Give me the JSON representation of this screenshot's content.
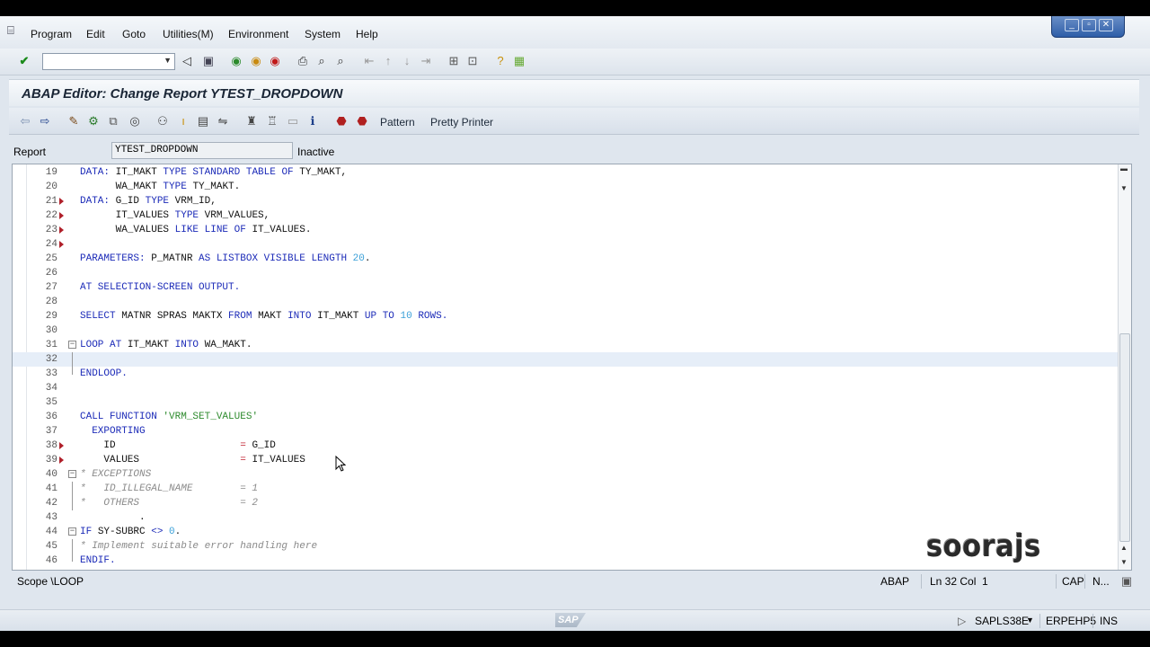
{
  "menu": {
    "items": [
      "Program",
      "Edit",
      "Goto",
      "Utilities(M)",
      "Environment",
      "System",
      "Help"
    ]
  },
  "window": {
    "title": "ABAP Editor: Change Report YTEST_DROPDOWN"
  },
  "apptoolbar": {
    "pattern_label": "Pattern",
    "pretty_printer_label": "Pretty Printer"
  },
  "report": {
    "label": "Report",
    "value": "YTEST_DROPDOWN",
    "status": "Inactive"
  },
  "code": {
    "current_line": 32,
    "lines": [
      {
        "n": "19",
        "bp": false,
        "fold": "",
        "parts": [
          [
            "kw",
            "DATA: "
          ],
          [
            "plain",
            "IT_MAKT "
          ],
          [
            "kw",
            "TYPE STANDARD TABLE OF "
          ],
          [
            "plain",
            "TY_MAKT,"
          ]
        ]
      },
      {
        "n": "20",
        "bp": false,
        "fold": "",
        "parts": [
          [
            "plain",
            "      WA_MAKT "
          ],
          [
            "kw",
            "TYPE "
          ],
          [
            "plain",
            "TY_MAKT."
          ]
        ]
      },
      {
        "n": "21",
        "bp": true,
        "fold": "",
        "parts": [
          [
            "kw",
            "DATA: "
          ],
          [
            "plain",
            "G_ID "
          ],
          [
            "kw",
            "TYPE "
          ],
          [
            "plain",
            "VRM_ID,"
          ]
        ]
      },
      {
        "n": "22",
        "bp": true,
        "fold": "",
        "parts": [
          [
            "plain",
            "      IT_VALUES "
          ],
          [
            "kw",
            "TYPE "
          ],
          [
            "plain",
            "VRM_VALUES,"
          ]
        ]
      },
      {
        "n": "23",
        "bp": true,
        "fold": "",
        "parts": [
          [
            "plain",
            "      WA_VALUES "
          ],
          [
            "kw",
            "LIKE LINE OF "
          ],
          [
            "plain",
            "IT_VALUES."
          ]
        ]
      },
      {
        "n": "24",
        "bp": true,
        "fold": "",
        "parts": []
      },
      {
        "n": "25",
        "bp": false,
        "fold": "",
        "parts": [
          [
            "kw",
            "PARAMETERS: "
          ],
          [
            "plain",
            "P_MATNR "
          ],
          [
            "kw",
            "AS LISTBOX VISIBLE LENGTH "
          ],
          [
            "num",
            "20"
          ],
          [
            "plain",
            "."
          ]
        ]
      },
      {
        "n": "26",
        "bp": false,
        "fold": "",
        "parts": []
      },
      {
        "n": "27",
        "bp": false,
        "fold": "",
        "parts": [
          [
            "kw",
            "AT SELECTION-SCREEN OUTPUT."
          ]
        ]
      },
      {
        "n": "28",
        "bp": false,
        "fold": "",
        "parts": []
      },
      {
        "n": "29",
        "bp": false,
        "fold": "",
        "parts": [
          [
            "kw",
            "SELECT "
          ],
          [
            "plain",
            "MATNR SPRAS MAKTX "
          ],
          [
            "kw",
            "FROM "
          ],
          [
            "plain",
            "MAKT "
          ],
          [
            "kw",
            "INTO "
          ],
          [
            "plain",
            "IT_MAKT "
          ],
          [
            "kw",
            "UP TO "
          ],
          [
            "num",
            "10 "
          ],
          [
            "kw",
            "ROWS."
          ]
        ]
      },
      {
        "n": "30",
        "bp": false,
        "fold": "",
        "parts": []
      },
      {
        "n": "31",
        "bp": false,
        "fold": "open",
        "parts": [
          [
            "kw",
            "LOOP AT "
          ],
          [
            "plain",
            "IT_MAKT "
          ],
          [
            "kw",
            "INTO "
          ],
          [
            "plain",
            "WA_MAKT."
          ]
        ]
      },
      {
        "n": "32",
        "bp": false,
        "fold": "line",
        "parts": []
      },
      {
        "n": "33",
        "bp": false,
        "fold": "end",
        "parts": [
          [
            "kw",
            "ENDLOOP."
          ]
        ]
      },
      {
        "n": "34",
        "bp": false,
        "fold": "",
        "parts": []
      },
      {
        "n": "35",
        "bp": false,
        "fold": "",
        "parts": []
      },
      {
        "n": "36",
        "bp": false,
        "fold": "",
        "parts": [
          [
            "kw",
            "CALL FUNCTION "
          ],
          [
            "str",
            "'VRM_SET_VALUES'"
          ]
        ]
      },
      {
        "n": "37",
        "bp": false,
        "fold": "",
        "parts": [
          [
            "kw",
            "  EXPORTING"
          ]
        ]
      },
      {
        "n": "38",
        "bp": true,
        "fold": "",
        "parts": [
          [
            "plain",
            "    ID                     "
          ],
          [
            "op",
            "= "
          ],
          [
            "plain",
            "G_ID"
          ]
        ]
      },
      {
        "n": "39",
        "bp": true,
        "fold": "",
        "parts": [
          [
            "plain",
            "    VALUES                 "
          ],
          [
            "op",
            "= "
          ],
          [
            "plain",
            "IT_VALUES"
          ]
        ]
      },
      {
        "n": "40",
        "bp": false,
        "fold": "open",
        "parts": [
          [
            "cmt",
            "* EXCEPTIONS"
          ]
        ]
      },
      {
        "n": "41",
        "bp": false,
        "fold": "line",
        "parts": [
          [
            "cmt",
            "*   ID_ILLEGAL_NAME        = 1"
          ]
        ]
      },
      {
        "n": "42",
        "bp": false,
        "fold": "line",
        "parts": [
          [
            "cmt",
            "*   OTHERS                 = 2"
          ]
        ]
      },
      {
        "n": "43",
        "bp": false,
        "fold": "",
        "parts": [
          [
            "plain",
            "          ."
          ]
        ]
      },
      {
        "n": "44",
        "bp": false,
        "fold": "open",
        "parts": [
          [
            "kw",
            "IF "
          ],
          [
            "plain",
            "SY-SUBRC "
          ],
          [
            "kw",
            "<> "
          ],
          [
            "num",
            "0"
          ],
          [
            "plain",
            "."
          ]
        ]
      },
      {
        "n": "45",
        "bp": false,
        "fold": "line",
        "parts": [
          [
            "cmt",
            "* Implement suitable error handling here"
          ]
        ]
      },
      {
        "n": "46",
        "bp": false,
        "fold": "end",
        "parts": [
          [
            "kw",
            "ENDIF."
          ]
        ]
      }
    ]
  },
  "status": {
    "scope": "Scope \\LOOP",
    "language": "ABAP",
    "position": "Ln 32 Col  1",
    "caps": "CAP",
    "num": "N..."
  },
  "sapbar": {
    "logo": "SAP",
    "program": "SAPLS38E",
    "server": "ERPEHP5",
    "mode": "INS"
  },
  "watermark": "soorajs"
}
